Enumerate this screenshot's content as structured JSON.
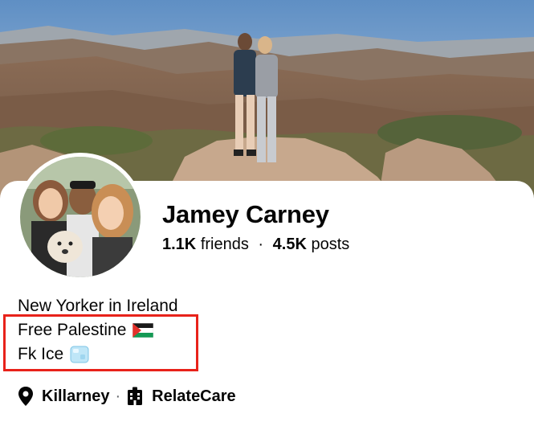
{
  "profile": {
    "name": "Jamey Carney",
    "friends_count": "1.1K",
    "friends_label": "friends",
    "separator": "·",
    "posts_count": "4.5K",
    "posts_label": "posts"
  },
  "bio": {
    "line1": "New Yorker in Ireland",
    "line2": "Free Palestine",
    "line2_emoji": "palestine-flag-icon",
    "line3": "Fk Ice",
    "line3_emoji": "ice-cube-icon"
  },
  "info": {
    "location": "Killarney",
    "separator": "·",
    "workplace": "RelateCare"
  },
  "colors": {
    "highlight_border": "#e8221a",
    "text": "#050505",
    "card_background": "#ffffff"
  }
}
